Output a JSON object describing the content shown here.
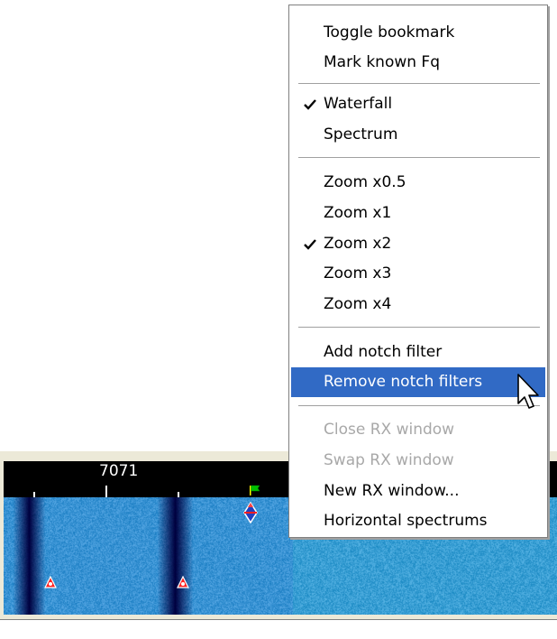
{
  "waterfall": {
    "frequency_label": "7071"
  },
  "context_menu": {
    "items": [
      {
        "label": "Toggle bookmark",
        "checked": false,
        "enabled": true,
        "highlighted": false
      },
      {
        "label": "Mark known Fq",
        "checked": false,
        "enabled": true,
        "highlighted": false
      },
      {
        "label": "Waterfall",
        "checked": true,
        "enabled": true,
        "highlighted": false
      },
      {
        "label": "Spectrum",
        "checked": false,
        "enabled": true,
        "highlighted": false
      },
      {
        "label": "Zoom x0.5",
        "checked": false,
        "enabled": true,
        "highlighted": false
      },
      {
        "label": "Zoom x1",
        "checked": false,
        "enabled": true,
        "highlighted": false
      },
      {
        "label": "Zoom x2",
        "checked": true,
        "enabled": true,
        "highlighted": false
      },
      {
        "label": "Zoom x3",
        "checked": false,
        "enabled": true,
        "highlighted": false
      },
      {
        "label": "Zoom x4",
        "checked": false,
        "enabled": true,
        "highlighted": false
      },
      {
        "label": "Add notch filter",
        "checked": false,
        "enabled": true,
        "highlighted": false
      },
      {
        "label": "Remove notch filters",
        "checked": false,
        "enabled": true,
        "highlighted": true
      },
      {
        "label": "Close RX window",
        "checked": false,
        "enabled": false,
        "highlighted": false
      },
      {
        "label": "Swap RX window",
        "checked": false,
        "enabled": false,
        "highlighted": false
      },
      {
        "label": "New RX window...",
        "checked": false,
        "enabled": true,
        "highlighted": false
      },
      {
        "label": "Horizontal spectrums",
        "checked": false,
        "enabled": true,
        "highlighted": false
      }
    ]
  },
  "colors": {
    "menu_highlight": "#316ac5",
    "disabled_text": "#a8a8a8",
    "waterfall_base": "#2a74b8",
    "notch_marker": "#ff2020",
    "bookmark_flag": "#00c000"
  },
  "icons": {
    "check": "check-icon",
    "cursor": "mouse-pointer-icon",
    "bookmark": "flag-icon",
    "notch": "notch-marker-icon",
    "rx": "rx-marker-icon"
  }
}
